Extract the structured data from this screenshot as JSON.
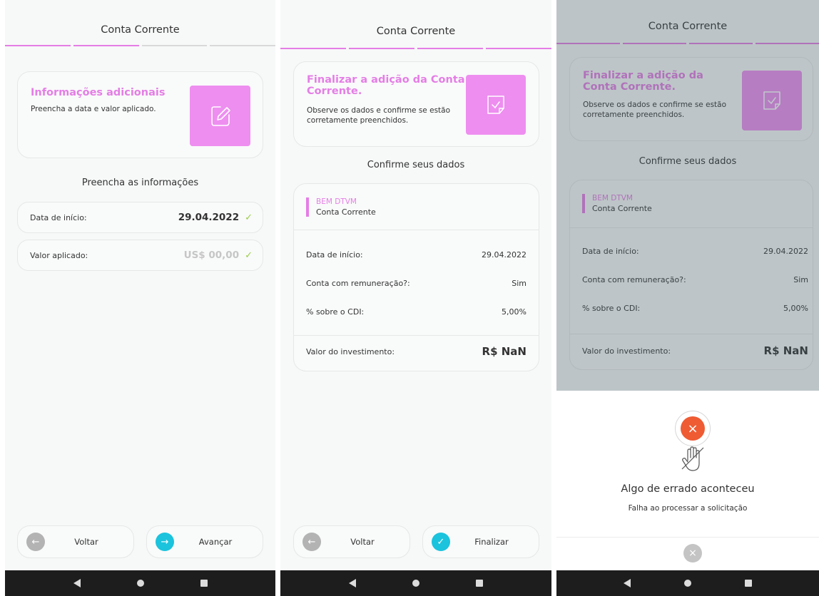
{
  "screen1": {
    "header_title": "Conta Corrente",
    "card": {
      "title": "Informações adicionais",
      "description": "Preencha a data e valor aplicado.",
      "icon": "edit-note-icon"
    },
    "section_title": "Preencha as informações",
    "fields": [
      {
        "label": "Data de início:",
        "value": "29.04.2022",
        "icon": "check-icon"
      },
      {
        "label": "Valor aplicado:",
        "placeholder": "US$ 00,00",
        "icon": "check-icon"
      }
    ],
    "buttons": {
      "back_label": "Voltar",
      "next_label": "Avançar"
    }
  },
  "screen2": {
    "header_title": "Conta Corrente",
    "card": {
      "title": "Finalizar a adição da Conta Corrente.",
      "description": "Observe os dados e confirme se estão corretamente preenchidos.",
      "icon": "note-check-icon"
    },
    "section_title": "Confirme seus dados",
    "summary": {
      "institution": "BEM DTVM",
      "account_type": "Conta Corrente",
      "rows": [
        {
          "label": "Data de início:",
          "value": "29.04.2022"
        },
        {
          "label": "Conta com remuneração?:",
          "value": "Sim"
        },
        {
          "label": "% sobre o CDI:",
          "value": "5,00%"
        }
      ],
      "total_label": "Valor do investimento:",
      "total_value": "R$ NaN"
    },
    "buttons": {
      "back_label": "Voltar",
      "finish_label": "Finalizar"
    }
  },
  "screen3": {
    "header_title": "Conta Corrente",
    "card": {
      "title": "Finalizar a adição da Conta Corrente.",
      "description": "Observe os dados e confirme se estão corretamente preenchidos."
    },
    "section_title": "Confirme seus dados",
    "summary": {
      "institution": "BEM DTVM",
      "account_type": "Conta Corrente",
      "rows": [
        {
          "label": "Data de início:",
          "value": "29.04.2022"
        },
        {
          "label": "Conta com remuneração?:",
          "value": "Sim"
        },
        {
          "label": "% sobre o CDI:",
          "value": "5,00%"
        }
      ],
      "total_label": "Valor do investimento:",
      "total_value": "R$ NaN"
    },
    "error_sheet": {
      "title": "Algo de errado aconteceu",
      "message": "Falha ao processar a solicitação",
      "icon": "error-x-icon",
      "illustration": "hand-icon"
    }
  },
  "colors": {
    "accent": "#e47ee5",
    "icon_bg": "#ee8ef0",
    "cyan": "#1bc3dd",
    "success": "#9ccb4a",
    "error": "#ef5b33",
    "navbar": "#1d1d1d"
  }
}
